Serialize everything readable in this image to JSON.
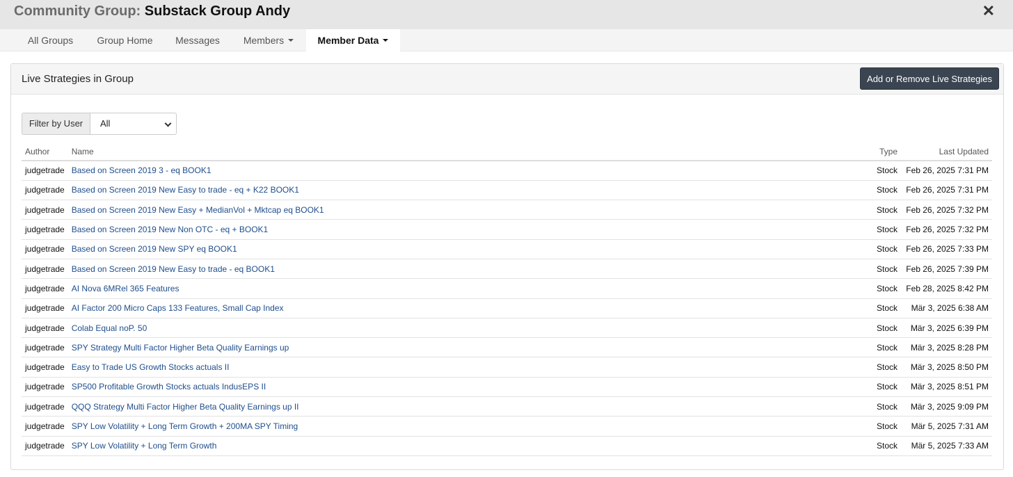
{
  "header": {
    "title_prefix": "Community Group:",
    "group_name": "Substack Group Andy",
    "close_glyph": "✕"
  },
  "tabs": [
    {
      "label": "All Groups",
      "dropdown": false,
      "active": false
    },
    {
      "label": "Group Home",
      "dropdown": false,
      "active": false
    },
    {
      "label": "Messages",
      "dropdown": false,
      "active": false
    },
    {
      "label": "Members",
      "dropdown": true,
      "active": false
    },
    {
      "label": "Member Data",
      "dropdown": true,
      "active": true
    }
  ],
  "panel": {
    "title": "Live Strategies in Group",
    "action_button": "Add or Remove Live Strategies"
  },
  "filter": {
    "label": "Filter by User",
    "selected": "All"
  },
  "table": {
    "columns": {
      "author": "Author",
      "name": "Name",
      "type": "Type",
      "updated": "Last Updated"
    },
    "rows": [
      {
        "author": "judgetrade",
        "name": "Based on Screen 2019 3 - eq BOOK1",
        "type": "Stock",
        "updated": "Feb 26, 2025 7:31 PM"
      },
      {
        "author": "judgetrade",
        "name": "Based on Screen 2019 New Easy to trade - eq + K22 BOOK1",
        "type": "Stock",
        "updated": "Feb 26, 2025 7:31 PM"
      },
      {
        "author": "judgetrade",
        "name": "Based on Screen 2019 New Easy + MedianVol + Mktcap eq BOOK1",
        "type": "Stock",
        "updated": "Feb 26, 2025 7:32 PM"
      },
      {
        "author": "judgetrade",
        "name": "Based on Screen 2019 New Non OTC - eq + BOOK1",
        "type": "Stock",
        "updated": "Feb 26, 2025 7:32 PM"
      },
      {
        "author": "judgetrade",
        "name": "Based on Screen 2019 New SPY eq BOOK1",
        "type": "Stock",
        "updated": "Feb 26, 2025 7:33 PM"
      },
      {
        "author": "judgetrade",
        "name": "Based on Screen 2019 New Easy to trade - eq BOOK1",
        "type": "Stock",
        "updated": "Feb 26, 2025 7:39 PM"
      },
      {
        "author": "judgetrade",
        "name": "AI Nova 6MRel 365 Features",
        "type": "Stock",
        "updated": "Feb 28, 2025 8:42 PM"
      },
      {
        "author": "judgetrade",
        "name": "AI Factor 200 Micro Caps 133 Features, Small Cap Index",
        "type": "Stock",
        "updated": "Mär 3, 2025 6:38 AM"
      },
      {
        "author": "judgetrade",
        "name": "Colab Equal noP. 50",
        "type": "Stock",
        "updated": "Mär 3, 2025 6:39 PM"
      },
      {
        "author": "judgetrade",
        "name": "SPY Strategy Multi Factor Higher Beta Quality Earnings up",
        "type": "Stock",
        "updated": "Mär 3, 2025 8:28 PM"
      },
      {
        "author": "judgetrade",
        "name": "Easy to Trade US Growth Stocks actuals II",
        "type": "Stock",
        "updated": "Mär 3, 2025 8:50 PM"
      },
      {
        "author": "judgetrade",
        "name": "SP500 Profitable Growth Stocks actuals IndusEPS II",
        "type": "Stock",
        "updated": "Mär 3, 2025 8:51 PM"
      },
      {
        "author": "judgetrade",
        "name": "QQQ Strategy Multi Factor Higher Beta Quality Earnings up II",
        "type": "Stock",
        "updated": "Mär 3, 2025 9:09 PM"
      },
      {
        "author": "judgetrade",
        "name": "SPY Low Volatility + Long Term Growth + 200MA SPY Timing",
        "type": "Stock",
        "updated": "Mär 5, 2025 7:31 AM"
      },
      {
        "author": "judgetrade",
        "name": "SPY Low Volatility + Long Term Growth",
        "type": "Stock",
        "updated": "Mär 5, 2025 7:33 AM"
      }
    ]
  },
  "colors": {
    "link": "#1f4e8c",
    "button_dark": "#3b4552",
    "titlebar_bg": "#e6e6e6"
  }
}
